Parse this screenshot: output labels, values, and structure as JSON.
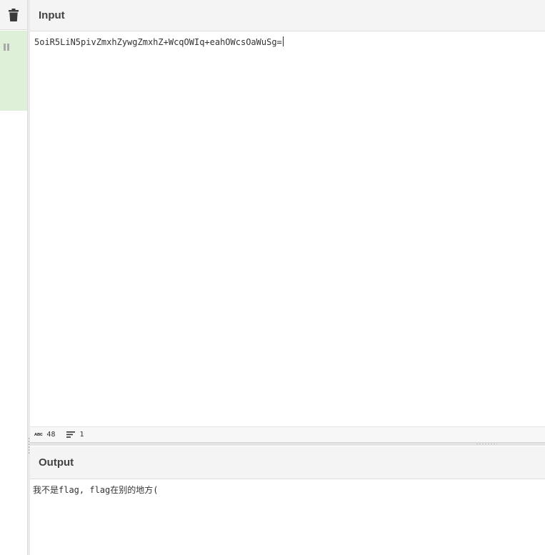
{
  "toolbar": {
    "clear_icon": "trash-icon",
    "pause_icon": "pause-icon"
  },
  "input": {
    "title": "Input",
    "value": "5oiR5LiN5pivZmxhZywgZmxhZ+WcqOWIq+eahOWcsOaWuSg=",
    "stats": {
      "length": "48",
      "lines": "1"
    }
  },
  "output": {
    "title": "Output",
    "value": "我不是flag, flag在别的地方("
  },
  "colors": {
    "header_bg": "#f4f4f4",
    "highlight_green": "#dff0d8",
    "text": "#333333"
  }
}
